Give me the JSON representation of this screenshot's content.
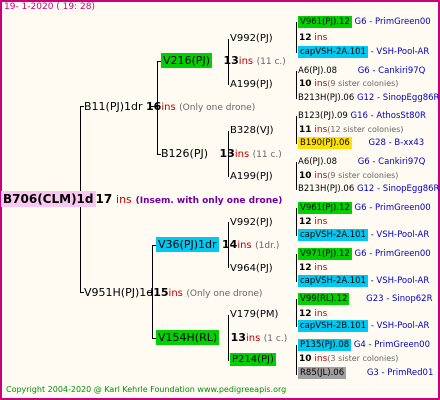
{
  "header": "19-  1-2020 (  19: 28)",
  "footer": "Copyright 2004-2020 @ Karl Kehrle Foundation    www.pedigreeapis.org",
  "root": {
    "name": "B706(CLM)1d",
    "num": "17",
    "ins": "ins",
    "note": "(Insem. with only one drone)"
  },
  "gen1": [
    {
      "name": "B11(PJ)1dr",
      "num": "16",
      "ins": "ins",
      "note": "(Only one drone)"
    },
    {
      "name": "V951H(PJ)1d",
      "num": "15",
      "ins": "ins",
      "note": "(Only one drone)"
    }
  ],
  "gen2": [
    {
      "name": "V216(PJ)",
      "num": "13",
      "ins": "ins",
      "note": "(11 c.)"
    },
    {
      "name": "B126(PJ)",
      "num": "13",
      "ins": "ins",
      "note": "(11 c.)"
    },
    {
      "name": "V36(PJ)1dr",
      "num": "14",
      "ins": "ins",
      "note": "(1dr.)"
    },
    {
      "name": "V154H(RL)",
      "num": "13",
      "ins": "ins",
      "note": "(1 c.)"
    }
  ],
  "gen3": [
    {
      "name": "V992(PJ)",
      "num": "12",
      "ins": "ins"
    },
    {
      "name": "A199(PJ)",
      "num": "10",
      "ins": "ins",
      "note": "(9 sister colonies)"
    },
    {
      "name": "B328(VJ)",
      "num": "11",
      "ins": "ins",
      "note": "(12 sister colonies)"
    },
    {
      "name": "A199(PJ)",
      "num": "10",
      "ins": "ins",
      "note": "(9 sister colonies)"
    },
    {
      "name": "V992(PJ)",
      "num": "12",
      "ins": "ins"
    },
    {
      "name": "V964(PJ)",
      "num": "12",
      "ins": "ins"
    },
    {
      "name": "V179(PM)",
      "num": "12",
      "ins": "ins"
    },
    {
      "name": "P214(PJ)",
      "num": "10",
      "ins": "ins",
      "note": "(3 sister colonies)"
    }
  ],
  "gen4": [
    {
      "name": "V961(PJ).12",
      "info": "G6 - PrimGreen00"
    },
    {
      "name": "capVSH-2A.101",
      "info": "- VSH-Pool-AR"
    },
    {
      "name": "A6(PJ).08",
      "info": "G6 - Cankiri97Q"
    },
    {
      "name": "B213H(PJ).06",
      "info": "G12 - SinopEgg86R"
    },
    {
      "name": "B123(PJ).09",
      "info": "G16 - AthosSt80R"
    },
    {
      "name": "B190(PJ).06",
      "info": "G28 - B-xx43"
    },
    {
      "name": "A6(PJ).08",
      "info": "G6 - Cankiri97Q"
    },
    {
      "name": "B213H(PJ).06",
      "info": "G12 - SinopEgg86R"
    },
    {
      "name": "V961(PJ).12",
      "info": "G6 - PrimGreen00"
    },
    {
      "name": "capVSH-2A.101",
      "info": "- VSH-Pool-AR"
    },
    {
      "name": "V971(PJ).12",
      "info": "G6 - PrimGreen00"
    },
    {
      "name": "capVSH-2A.101",
      "info": "- VSH-Pool-AR"
    },
    {
      "name": "V99(RL).12",
      "info": "G23 - Sinop62R"
    },
    {
      "name": "capVSH-2B.101",
      "info": "- VSH-Pool-AR"
    },
    {
      "name": "P135(PJ).08",
      "info": "G4 - PrimGreen00"
    },
    {
      "name": "R85(JL).06",
      "info": "G3 - PrimRed01"
    }
  ]
}
